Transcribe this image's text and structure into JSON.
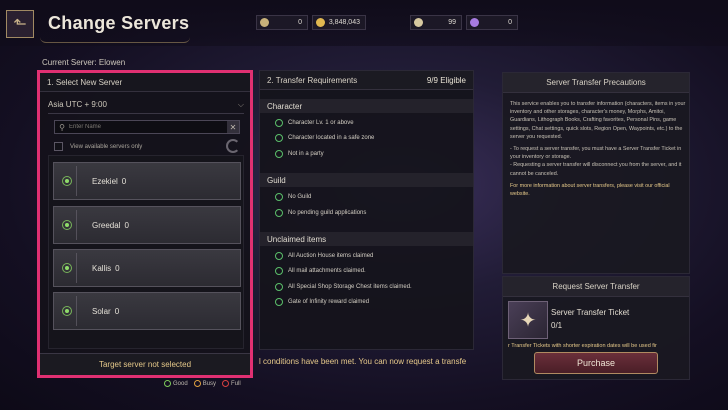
{
  "header": {
    "title": "Change Servers",
    "back_icon": "back-arrow-icon"
  },
  "currencies": [
    {
      "icon": "silver-icon",
      "color": "#c9b27a",
      "value": "0"
    },
    {
      "icon": "gold-icon",
      "color": "#e0b850",
      "value": "3,848,043"
    },
    {
      "icon": "crystal-icon",
      "color": "#d7c9a0",
      "value": "99"
    },
    {
      "icon": "phoenix-plume-icon",
      "color": "#a77be0",
      "value": "0"
    }
  ],
  "current_server": "Current Server: Elowen",
  "select_panel": {
    "title": "1. Select New Server",
    "region": "Asia UTC + 9:00",
    "search_placeholder": "Enter Name",
    "available_label": "View available servers only",
    "servers": [
      {
        "name": "Ezekiel",
        "count": "0",
        "status": "Good"
      },
      {
        "name": "Greedal",
        "count": "0",
        "status": "Good"
      },
      {
        "name": "Kallis",
        "count": "0",
        "status": "Good"
      },
      {
        "name": "Solar",
        "count": "0",
        "status": "Good"
      }
    ],
    "status_text": "Target server not selected"
  },
  "legend": [
    {
      "label": "Good",
      "color": "#7cc95a"
    },
    {
      "label": "Busy",
      "color": "#e0a040"
    },
    {
      "label": "Full",
      "color": "#d84040"
    }
  ],
  "requirements": {
    "title": "2. Transfer Requirements",
    "eligible": "9/9 Eligible",
    "sections": [
      {
        "title": "Character",
        "items": [
          "Character Lv. 1 or above",
          "Character located in a safe zone",
          "Not in a party"
        ]
      },
      {
        "title": "Guild",
        "items": [
          "No Guild",
          "No pending guild applications"
        ]
      },
      {
        "title": "Unclaimed items",
        "items": [
          "All Auction House items claimed",
          "All mail attachments claimed.",
          "All Special Shop Storage Chest items claimed.",
          "Gate of Infinity reward claimed"
        ]
      }
    ],
    "bottom_text": "l conditions have been met. You can now request a transfe"
  },
  "precautions": {
    "title": "Server Transfer Precautions",
    "paragraphs": [
      "This service enables you to transfer information (characters, items in your inventory and other storages, character's money, Morphs, Amitoi, Guardians, Lithograph Books, Crafting favorites, Personal Pins, game settings, Chat settings, quick slots, Region Open, Waypoints, etc.) to the server you requested.",
      "- To request a server transfer, you must have a Server Transfer Ticket in your inventory or storage.\n- Requesting a server transfer will disconnect you from the server, and it cannot be canceled.",
      "For more information about server transfers, please visit our official website."
    ]
  },
  "request": {
    "title": "Request Server Transfer",
    "ticket_name": "Server Transfer Ticket",
    "ticket_qty": "0/1",
    "note": "r Transfer Tickets with shorter expiration dates will be used fir",
    "purchase_label": "Purchase"
  }
}
